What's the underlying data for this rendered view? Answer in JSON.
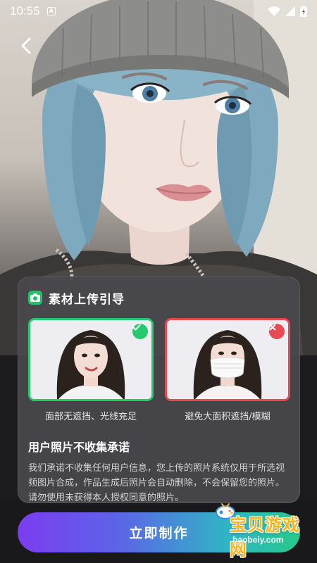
{
  "status_bar": {
    "time": "10:55",
    "notification_letter": "A"
  },
  "navigation": {
    "back_icon": "chevron-left-icon"
  },
  "guide": {
    "title": "素材上传引导",
    "title_icon": "camera-icon",
    "accent_color": "#23c267",
    "good_example": {
      "caption": "面部无遮挡、光线充足",
      "status_icon": "check-icon",
      "color": "#26c96b"
    },
    "bad_example": {
      "caption": "避免大面积遮挡/模糊",
      "status_icon": "close-icon",
      "color": "#e84a51"
    },
    "privacy": {
      "title": "用户照片不收集承诺",
      "text": "我们承诺不收集任何用户信息，您上传的照片系统仅用于所选视频图片合成，作品生成后照片会自动删除，不会保留您的照片。请勿使用未获得本人授权同意的照片。"
    }
  },
  "action": {
    "create_label": "立即制作"
  },
  "watermark": {
    "text": "宝贝游戏网",
    "url": "baobeiy.com"
  }
}
